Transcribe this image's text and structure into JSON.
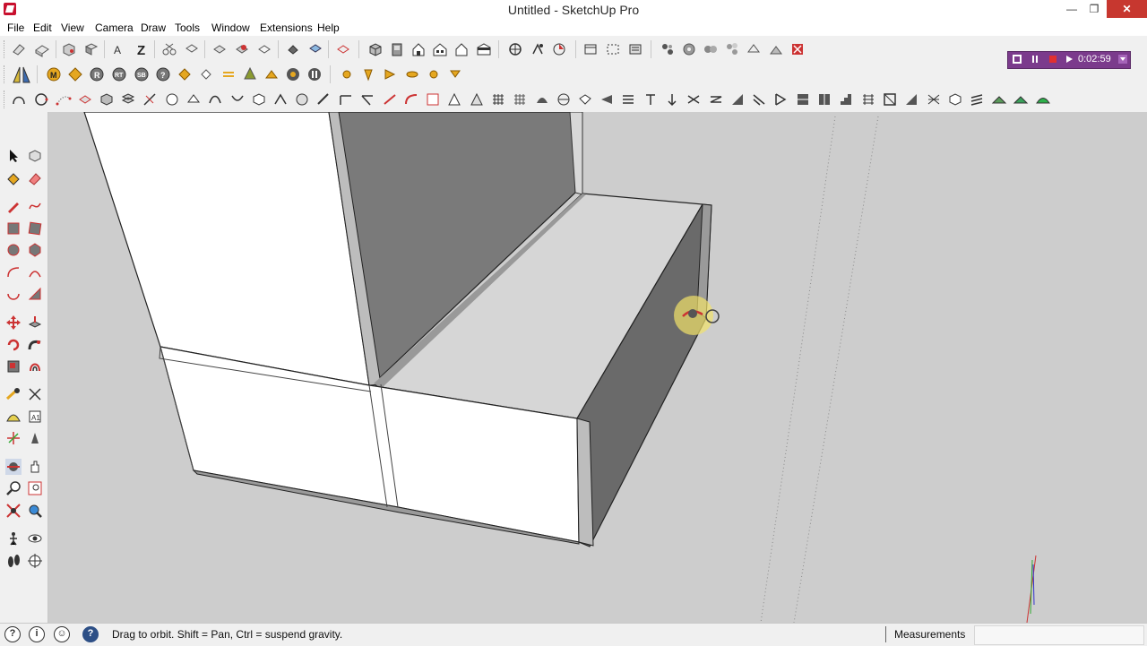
{
  "window": {
    "title": "Untitled - SketchUp Pro",
    "minimize_label": "—",
    "maximize_label": "❐",
    "close_label": "✕"
  },
  "menu": {
    "items": [
      "File",
      "Edit",
      "View",
      "Camera",
      "Draw",
      "Tools",
      "Window",
      "Extensions",
      "Help"
    ]
  },
  "recorder": {
    "time": "0:02:59"
  },
  "status": {
    "hint": "Drag to orbit. Shift = Pan, Ctrl = suspend gravity.",
    "measurements_label": "Measurements",
    "measurements_value": ""
  },
  "colors": {
    "accent_red": "#c8102e",
    "recorder_purple": "#7b3b8c",
    "canvas_bg": "#cdcdcd",
    "orbit_highlight": "#f2e36a"
  }
}
